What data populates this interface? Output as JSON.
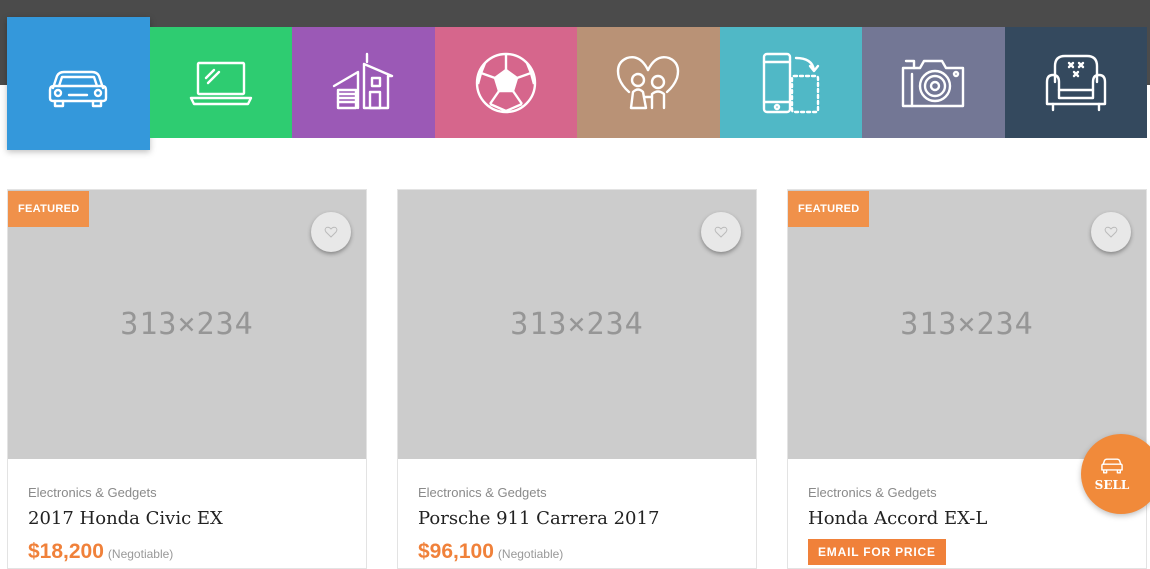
{
  "categories": [
    {
      "name": "cars",
      "icon": "car-icon",
      "color": "#3498db",
      "active": true
    },
    {
      "name": "electronics",
      "icon": "laptop-icon",
      "color": "#2ecc71",
      "active": false
    },
    {
      "name": "real-estate",
      "icon": "house-icon",
      "color": "#9b59b6",
      "active": false
    },
    {
      "name": "sports",
      "icon": "soccer-ball-icon",
      "color": "#d6668c",
      "active": false
    },
    {
      "name": "dating",
      "icon": "couple-heart-icon",
      "color": "#b99276",
      "active": false
    },
    {
      "name": "mobiles",
      "icon": "phone-icon",
      "color": "#50b8c6",
      "active": false
    },
    {
      "name": "cameras",
      "icon": "camera-icon",
      "color": "#737795",
      "active": false
    },
    {
      "name": "furniture",
      "icon": "armchair-icon",
      "color": "#34495e",
      "active": false
    }
  ],
  "listings": [
    {
      "featured": "FEATURED",
      "image_placeholder": "313×234",
      "category": "Electronics & Gedgets",
      "title": "2017 Honda Civic EX",
      "price": "$18,200",
      "price_note": "(Negotiable)"
    },
    {
      "featured": "",
      "image_placeholder": "313×234",
      "category": "Electronics & Gedgets",
      "title": "Porsche 911 Carrera 2017",
      "price": "$96,100",
      "price_note": "(Negotiable)"
    },
    {
      "featured": "FEATURED",
      "image_placeholder": "313×234",
      "category": "Electronics & Gedgets",
      "title": "Honda Accord EX-L",
      "email_button": "EMAIL FOR PRICE"
    }
  ],
  "sell_button": {
    "label": "SELL",
    "icon": "car-icon"
  },
  "colors": {
    "accent": "#f0813a",
    "topbar": "#4b4b4b"
  }
}
